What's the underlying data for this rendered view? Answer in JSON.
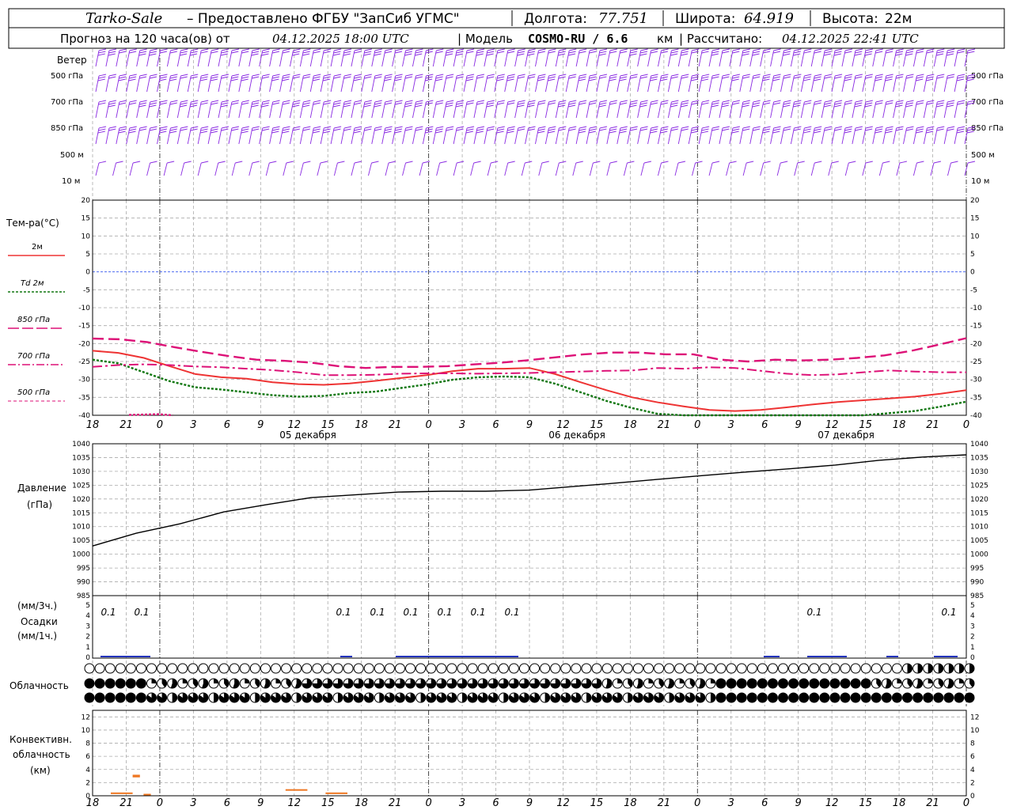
{
  "header": {
    "station": "Tarko-Sale",
    "provider": "– Предоставлено ФГБУ \"ЗапСиб УГМС\"",
    "lon_label": "Долгота:",
    "lon_value": "77.751",
    "lat_label": "Широта:",
    "lat_value": "64.919",
    "alt_label": "Высота:",
    "alt_value": "22м",
    "forecast_label": "Прогноз на 120 часа(ов) от",
    "forecast_time": "04.12.2025 18:00 UTC",
    "model_label": "| Модель",
    "model_name": "COSMO-RU / 6.6",
    "model_unit": "км",
    "calc_label": "| Рассчитано:",
    "calc_time": "04.12.2025 22:41 UTC"
  },
  "wind_panel": {
    "title": "Ветер",
    "levels": [
      "500 гПа",
      "700 гПа",
      "850 гПа",
      "500 м",
      "10  м"
    ],
    "color": "#8a2be2"
  },
  "temp_panel": {
    "title": "Тем-ра(°С)",
    "legend": [
      {
        "label": "2м",
        "color": "#ee3333"
      },
      {
        "label": "Td  2м",
        "color": "#117711"
      },
      {
        "label": "850 гПа",
        "color": "#dd1177"
      },
      {
        "label": "700 гПа",
        "color": "#dd1177"
      },
      {
        "label": "500 гПа",
        "color": "#dd1177"
      }
    ],
    "yticks": [
      "20",
      "15",
      "10",
      "5",
      "0",
      "-5",
      "-10",
      "-15",
      "-20",
      "-25",
      "-30",
      "-35",
      "-40"
    ]
  },
  "x_axis": {
    "ticks": [
      "18",
      "21",
      "0",
      "3",
      "6",
      "9",
      "12",
      "15",
      "18",
      "21",
      "0",
      "3",
      "6",
      "9",
      "12",
      "15",
      "18",
      "21",
      "0",
      "3",
      "6",
      "9",
      "12",
      "15",
      "18",
      "21",
      "0"
    ],
    "days": [
      "05 декабря",
      "06 декабря",
      "07 декабря"
    ]
  },
  "pressure_panel": {
    "title": "Давление",
    "unit": "(гПа)",
    "yticks": [
      "1040",
      "1035",
      "1030",
      "1025",
      "1020",
      "1015",
      "1010",
      "1005",
      "1000",
      "995",
      "990",
      "985"
    ]
  },
  "precip_panel": {
    "unit_top": "(мм/3ч.)",
    "title": "Осадки",
    "unit_bottom": "(мм/1ч.)",
    "yticks": [
      "5",
      "4",
      "3",
      "2",
      "1",
      "0"
    ],
    "values": [
      "0.1",
      "0.1",
      "0.1",
      "0.1",
      "0.1",
      "0.1",
      "0.1",
      "0.1",
      "0.1",
      "0.1"
    ]
  },
  "cloud_panel": {
    "title": "Облачность"
  },
  "conv_panel": {
    "title1": "Конвективн.",
    "title2": "облачность",
    "unit": "(км)",
    "yticks": [
      "12",
      "10",
      "8",
      "6",
      "4",
      "2",
      "0"
    ],
    "color": "#ee7722"
  },
  "chart_data": [
    {
      "type": "line",
      "title": "Тем-ра(°С)",
      "x_hours": [
        0,
        3,
        6,
        9,
        12,
        15,
        18,
        21,
        24,
        27,
        30,
        33,
        36,
        39,
        42,
        45,
        48,
        51,
        54,
        57,
        60,
        63,
        66,
        69,
        72,
        75,
        78,
        81,
        84,
        87,
        90,
        93,
        96,
        99,
        102,
        105,
        108,
        111,
        114,
        117,
        120
      ],
      "ylim": [
        -40,
        20
      ],
      "series": [
        {
          "name": "2м",
          "values": [
            -22,
            -22.6,
            -24,
            -26.3,
            -28.5,
            -29.4,
            -29.8,
            -30.8,
            -31.3,
            -31.5,
            -31.1,
            -30.4,
            -29.6,
            -28.8,
            -27.7,
            -27,
            -27,
            -26.8,
            -28.5,
            -30.8,
            -33,
            -35,
            -36.4,
            -37.5,
            -38.5,
            -38.8,
            -38.5,
            -37.8,
            -37,
            -36.3,
            -35.8,
            -35.3,
            -34.8,
            -34,
            -33
          ]
        },
        {
          "name": "Td  2м",
          "values": [
            -24.5,
            -25.5,
            -28,
            -30.5,
            -32.2,
            -32.8,
            -33.6,
            -34.4,
            -34.8,
            -34.6,
            -33.8,
            -33.4,
            -32.4,
            -31.4,
            -30.1,
            -29.4,
            -29.2,
            -29.4,
            -31.2,
            -33.6,
            -36,
            -38,
            -39.6,
            -41,
            -42,
            -43,
            -43,
            -42.4,
            -42,
            -41,
            -40,
            -39.4,
            -38.8,
            -37.6,
            -36.2
          ]
        },
        {
          "name": "850 гПа",
          "values": [
            -18.6,
            -18.8,
            -19.6,
            -21,
            -22.3,
            -23.5,
            -24.5,
            -24.8,
            -25.3,
            -26.3,
            -26.8,
            -26.5,
            -26.5,
            -26.3,
            -25.8,
            -25.3,
            -24.6,
            -23.8,
            -23,
            -22.5,
            -22.5,
            -23,
            -23,
            -24.5,
            -25,
            -24.5,
            -24.7,
            -24.5,
            -24,
            -23.3,
            -22,
            -20.3,
            -18.5
          ]
        },
        {
          "name": "700 гПа",
          "values": [
            -26.5,
            -26,
            -25.8,
            -26,
            -26.4,
            -26.6,
            -27,
            -27.4,
            -28,
            -28.8,
            -28.8,
            -28.7,
            -28.4,
            -28.3,
            -28.3,
            -28.4,
            -28.3,
            -28.2,
            -28,
            -27.8,
            -27.6,
            -27.5,
            -26.8,
            -27,
            -26.6,
            -26.8,
            -27.6,
            -28.4,
            -28.8,
            -28.6,
            -28,
            -27.5,
            -27.8,
            -28,
            -28
          ]
        },
        {
          "name": "500 гПа",
          "values": [
            -39.9,
            -39.8,
            -39.7,
            -40
          ]
        }
      ]
    },
    {
      "type": "line",
      "title": "Давление",
      "ylim": [
        985,
        1040
      ],
      "x_hours": [
        0,
        6,
        12,
        18,
        24,
        30,
        36,
        42,
        48,
        54,
        60,
        66,
        72,
        78,
        84,
        90,
        96,
        102,
        108,
        114,
        120
      ],
      "values": [
        1003,
        1007.6,
        1011,
        1015.3,
        1018,
        1020.5,
        1021.5,
        1022.5,
        1022.8,
        1022.8,
        1023.2,
        1024.5,
        1025.8,
        1027.2,
        1028.5,
        1029.8,
        1031,
        1032.3,
        1034,
        1035.2,
        1036
      ]
    },
    {
      "type": "bar",
      "title": "Конвективн. облачность",
      "ylim": [
        0,
        13
      ],
      "segments": [
        {
          "x_hours": [
            2.5,
            5.5
          ],
          "base_km": 0,
          "top_km": 0.5
        },
        {
          "x_hours": [
            5.5,
            6.5
          ],
          "base_km": 2.8,
          "top_km": 3.2
        },
        {
          "x_hours": [
            7,
            8
          ],
          "base_km": 0,
          "top_km": 0.3
        },
        {
          "x_hours": [
            26.5,
            29.5
          ],
          "base_km": 0.7,
          "top_km": 1
        },
        {
          "x_hours": [
            32,
            35
          ],
          "base_km": 0.3,
          "top_km": 0.5
        }
      ]
    }
  ]
}
